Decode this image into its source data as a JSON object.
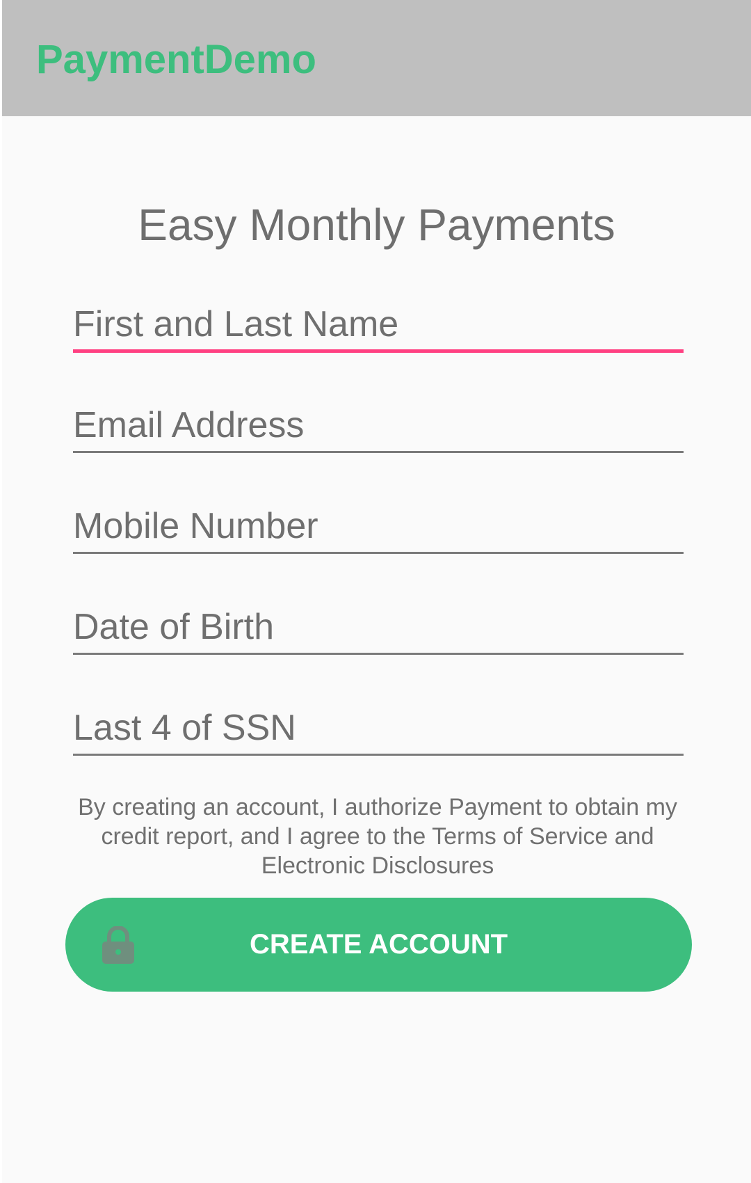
{
  "app_bar": {
    "title": "PaymentDemo",
    "title_color": "#3dbe7e",
    "background": "#bfbfbf"
  },
  "form": {
    "heading": "Easy Monthly Payments",
    "fields": [
      {
        "placeholder": "First and Last Name",
        "value": "",
        "focused": true
      },
      {
        "placeholder": "Email Address",
        "value": "",
        "focused": false
      },
      {
        "placeholder": "Mobile Number",
        "value": "",
        "focused": false
      },
      {
        "placeholder": "Date of Birth",
        "value": "",
        "focused": false
      },
      {
        "placeholder": "Last 4 of SSN",
        "value": "",
        "focused": false
      }
    ],
    "disclaimer": "By creating an account, I authorize Payment to obtain my credit report, and I agree to the Terms of Service and Electronic Disclosures",
    "submit": {
      "label": "CREATE ACCOUNT",
      "icon": "lock-icon",
      "color": "#3dbe7e"
    }
  },
  "colors": {
    "accent": "#3dbe7e",
    "focus_underline": "#ff4081",
    "underline": "#7a7a7a",
    "text_secondary": "#6e6e6e"
  }
}
